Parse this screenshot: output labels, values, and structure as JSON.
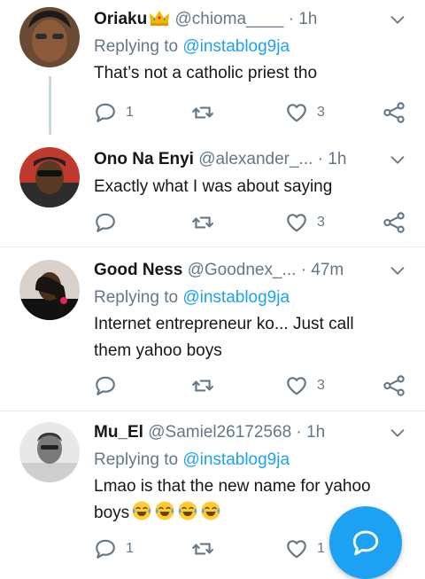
{
  "tweets": [
    {
      "name": "Oriaku",
      "handle": "@chioma____",
      "dot": "·",
      "time": "1h",
      "replying_prefix": "Replying to ",
      "replying_user": "@instablog9ja",
      "text": "That’s not a catholic priest tho",
      "reply_count": "1",
      "retweet_count": "",
      "like_count": "3"
    },
    {
      "name": "Ono Na Enyi",
      "handle": "@alexander_...",
      "dot": "·",
      "time": "1h",
      "text": "Exactly what I was about saying",
      "reply_count": "",
      "retweet_count": "",
      "like_count": "3"
    },
    {
      "name": "Good Ness",
      "handle": "@Goodnex_...",
      "dot": "·",
      "time": "47m",
      "replying_prefix": "Replying to ",
      "replying_user": "@instablog9ja",
      "text_line1": "Internet entrepreneur ko... Just call",
      "text_line2": "them yahoo boys",
      "reply_count": "",
      "retweet_count": "",
      "like_count": "3"
    },
    {
      "name": "Mu_El",
      "handle": "@Samiel26172568",
      "dot": "·",
      "time": "1h",
      "replying_prefix": "Replying to ",
      "replying_user": "@instablog9ja",
      "text_line1": "Lmao is that the new name for yahoo",
      "text_line2": "boys",
      "reply_count": "1",
      "like_count": "1"
    }
  ],
  "colors": {
    "accent": "#1da1f2",
    "muted": "#657786",
    "text": "#14171a",
    "divider": "#e6ecf0"
  },
  "icons": [
    "crown-icon",
    "chevron-down-icon",
    "reply-icon",
    "retweet-icon",
    "like-icon",
    "share-icon",
    "crying-laughing-emoji",
    "compose-reply-icon"
  ]
}
